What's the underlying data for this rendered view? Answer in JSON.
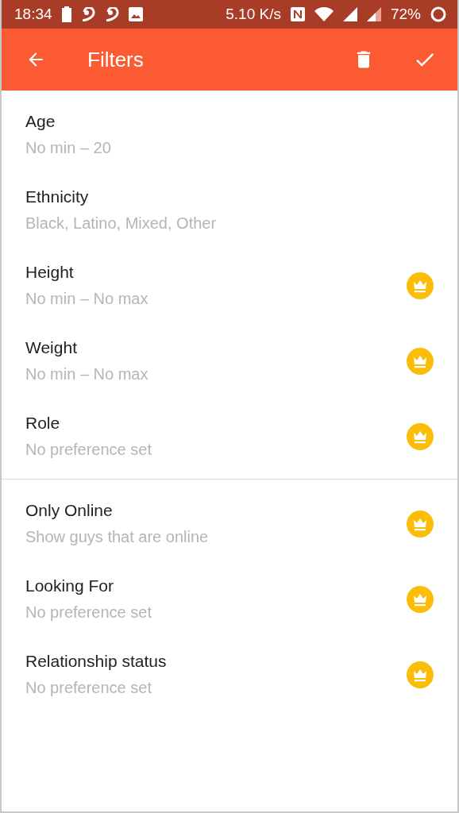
{
  "status_bar": {
    "time": "18:34",
    "speed": "5.10 K/s",
    "battery": "72%"
  },
  "toolbar": {
    "title": "Filters"
  },
  "sections": [
    {
      "items": [
        {
          "title": "Age",
          "value": "No min – 20",
          "premium": false
        },
        {
          "title": "Ethnicity",
          "value": "Black, Latino, Mixed, Other",
          "premium": false
        },
        {
          "title": "Height",
          "value": "No min – No max",
          "premium": true
        },
        {
          "title": "Weight",
          "value": "No min – No max",
          "premium": true
        },
        {
          "title": "Role",
          "value": "No preference set",
          "premium": true
        }
      ]
    },
    {
      "items": [
        {
          "title": "Only Online",
          "value": "Show guys that are online",
          "premium": true
        },
        {
          "title": "Looking For",
          "value": "No preference set",
          "premium": true
        },
        {
          "title": "Relationship status",
          "value": "No preference set",
          "premium": true
        }
      ]
    }
  ]
}
